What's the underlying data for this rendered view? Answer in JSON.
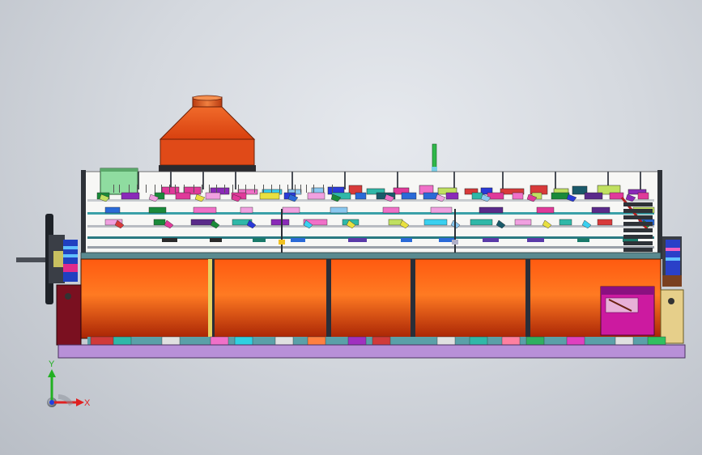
{
  "scene": {
    "kind": "cad-assembly-front-view",
    "colors": {
      "background_center": "#e6e9ee",
      "background_edge": "#b9bec6",
      "hood": "#e0451a",
      "hood_collar": "#d9531f",
      "tank_light": "#ff6a1a",
      "tank_dark": "#b02a05",
      "base_plate": "#b890d8",
      "left_end_cap": "#7a1020",
      "right_end_cap": "#e6cf8a",
      "right_cabinet": "#cc1aa0",
      "frame": "#3a3f46",
      "shaft": "#4a4e56"
    },
    "tank_segment_count": 5,
    "shelf_count": 5
  },
  "triad": {
    "x_label": "X",
    "y_label": "Y",
    "x_color": "#e02020",
    "y_color": "#22b022",
    "z_color": "#2040e0"
  }
}
